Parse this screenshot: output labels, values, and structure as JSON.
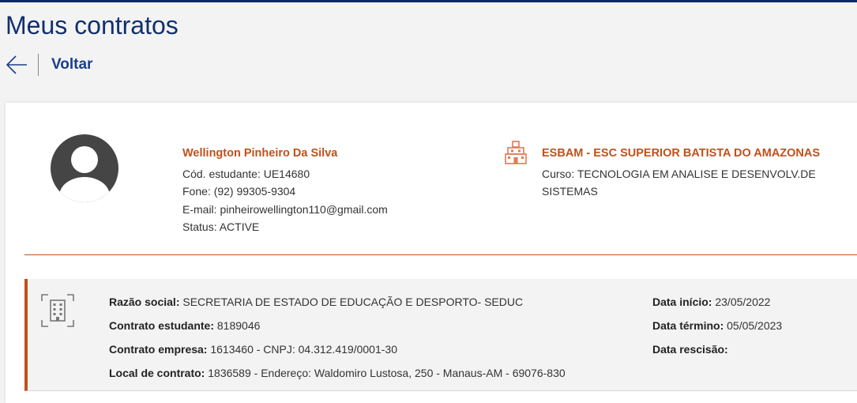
{
  "page": {
    "title": "Meus contratos",
    "back_label": "Voltar"
  },
  "student": {
    "name": "Wellington Pinheiro Da Silva",
    "code": "Cód. estudante: UE14680",
    "phone": "Fone: (92) 99305-9304",
    "email": "E-mail: pinheirowellington110@gmail.com",
    "status": "Status: ACTIVE"
  },
  "school": {
    "name": "ESBAM - ESC SUPERIOR BATISTA DO AMAZONAS",
    "course": "Curso: TECNOLOGIA EM ANALISE E DESENVOLV.DE SISTEMAS"
  },
  "contract": {
    "razao_label": "Razão social:",
    "razao_value": "SECRETARIA DE ESTADO DE EDUCAÇÃO E DESPORTO- SEDUC",
    "contrato_estudante_label": "Contrato estudante:",
    "contrato_estudante_value": "8189046",
    "contrato_empresa_label": "Contrato empresa:",
    "contrato_empresa_value": "1613460 - CNPJ: 04.312.419/0001-30",
    "local_label": "Local de contrato:",
    "local_value": "1836589 - Endereço: Waldomiro Lustosa, 250 - Manaus-AM - 69076-830",
    "data_inicio_label": "Data início:",
    "data_inicio_value": "23/05/2022",
    "data_termino_label": "Data término:",
    "data_termino_value": "05/05/2023",
    "data_rescisao_label": "Data rescisão:",
    "data_rescisao_value": ""
  },
  "icons": {
    "back": "arrow-left-icon",
    "avatar": "user-avatar-icon",
    "school": "school-building-icon",
    "company": "office-building-icon"
  },
  "colors": {
    "title": "#10306e",
    "accent": "#c0511a",
    "top_bar": "#0b2a6b"
  }
}
